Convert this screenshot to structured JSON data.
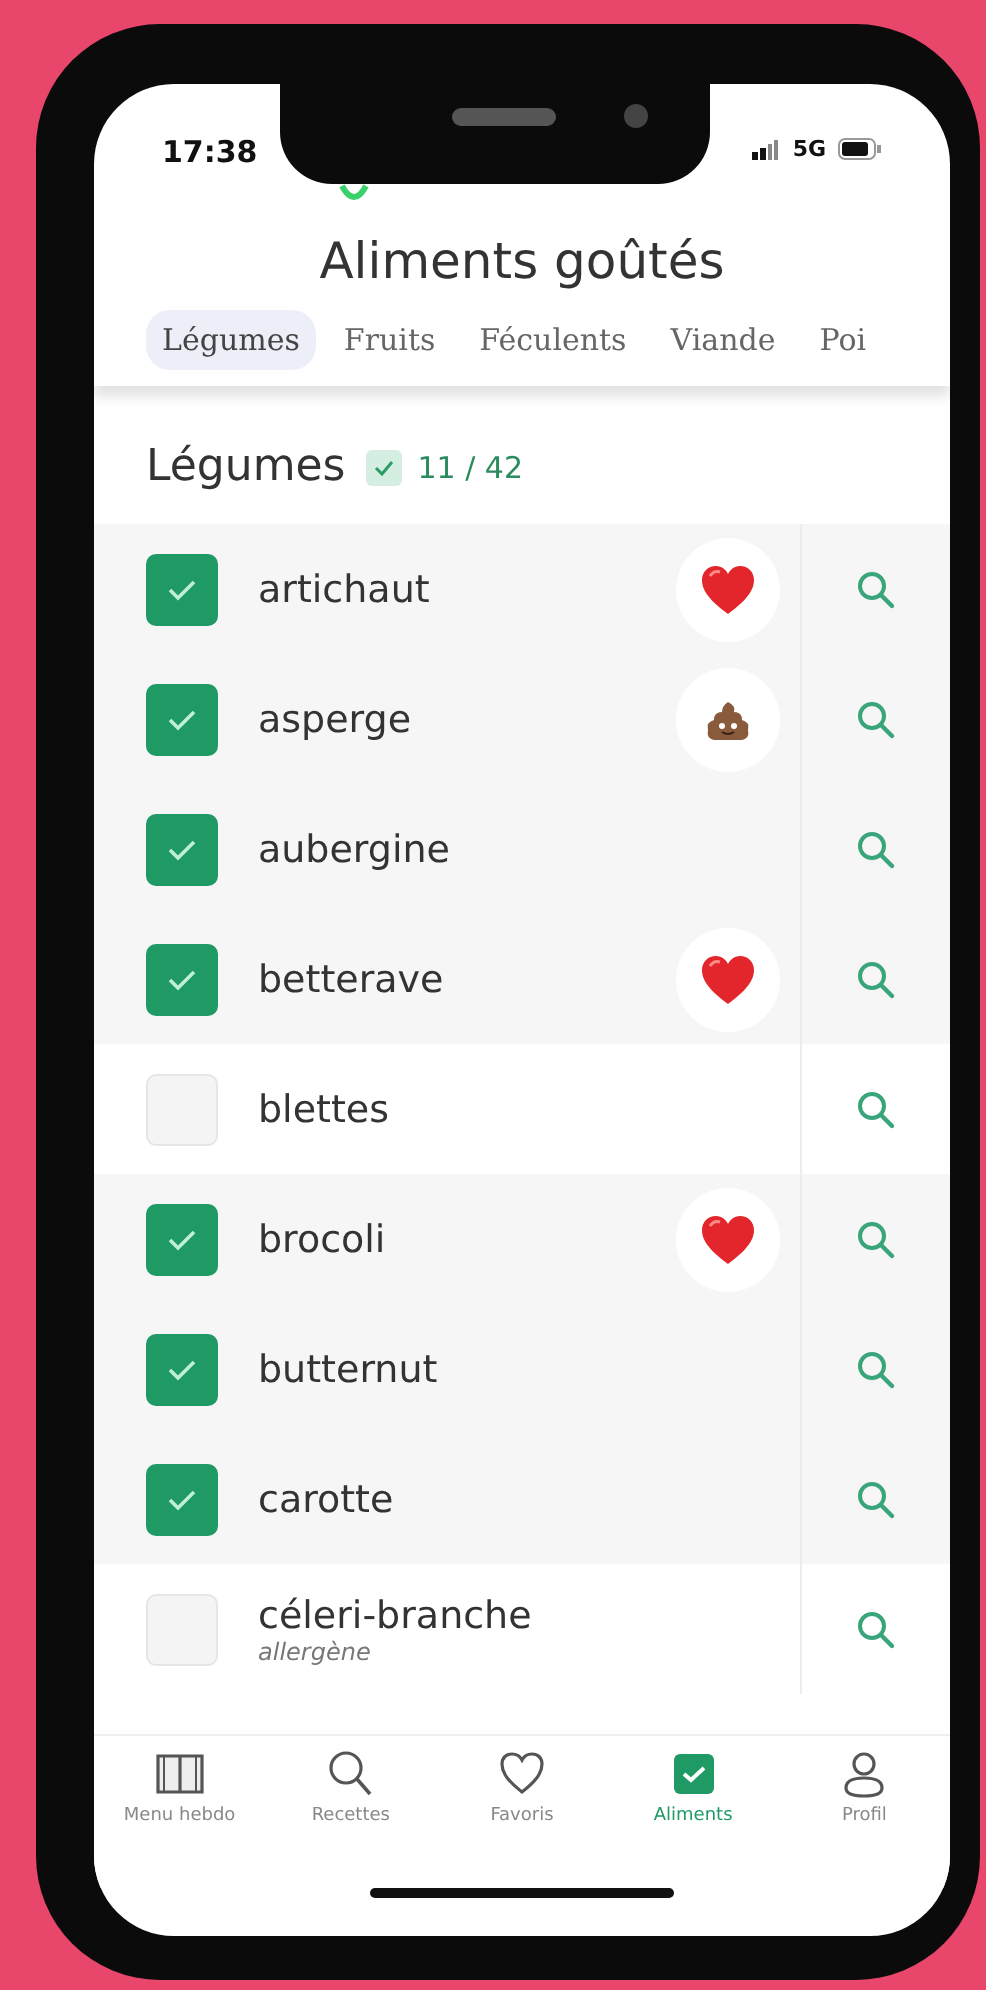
{
  "status_bar": {
    "time": "17:38",
    "network": "5G"
  },
  "title": "Aliments goûtés",
  "tabs": [
    {
      "label": "Légumes",
      "selected": true
    },
    {
      "label": "Fruits",
      "selected": false
    },
    {
      "label": "Féculents",
      "selected": false
    },
    {
      "label": "Viande",
      "selected": false
    },
    {
      "label": "Poi",
      "selected": false
    }
  ],
  "section": {
    "title": "Légumes",
    "count": "11 / 42"
  },
  "items": [
    {
      "name": "artichaut",
      "checked": true,
      "kind": "heart"
    },
    {
      "name": "asperge",
      "checked": true,
      "kind": "poop"
    },
    {
      "name": "aubergine",
      "checked": true,
      "kind": "plain"
    },
    {
      "name": "betterave",
      "checked": true,
      "kind": "heart"
    },
    {
      "name": "blettes",
      "checked": false,
      "kind": "plain"
    },
    {
      "name": "brocoli",
      "checked": true,
      "kind": "heart"
    },
    {
      "name": "butternut",
      "checked": true,
      "kind": "plain"
    },
    {
      "name": "carotte",
      "checked": true,
      "kind": "plain"
    },
    {
      "name": "céleri-branche",
      "checked": false,
      "kind": "plain",
      "note": "allergène"
    }
  ],
  "nav": [
    {
      "label": "Menu hebdo",
      "selected": false
    },
    {
      "label": "Recettes",
      "selected": false
    },
    {
      "label": "Favoris",
      "selected": false
    },
    {
      "label": "Aliments",
      "selected": true
    },
    {
      "label": "Profil",
      "selected": false
    }
  ]
}
